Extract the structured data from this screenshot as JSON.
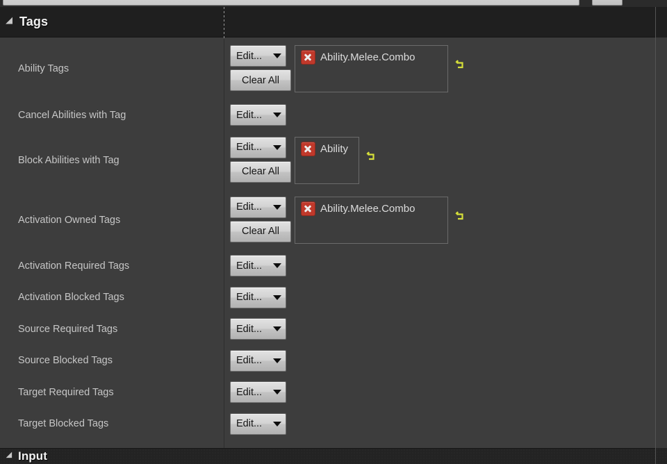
{
  "top_bar": {
    "search_placeholder": "",
    "search_value": "",
    "search_icon": "search-icon",
    "button_label": ""
  },
  "sections": [
    {
      "title": "Tags",
      "expanded": true,
      "triangle_icon": "triangle-down-icon"
    },
    {
      "title": "Input",
      "expanded": true,
      "triangle_icon": "triangle-down-icon"
    }
  ],
  "buttons": {
    "edit_label": "Edit...",
    "clear_all_label": "Clear All",
    "caret_icon": "chevron-down-icon",
    "revert_icon": "revert-arrow-icon",
    "remove_icon": "remove-x-icon"
  },
  "colors": {
    "panel_bg": "#3d3d3d",
    "header_bg": "#1f1f1f",
    "label_text": "#c6c6c6",
    "title_text": "#f1f1f1",
    "chip_remove": "#c0392b",
    "revert_arrow": "#d6e03a",
    "button_face": "#d2d2d2"
  },
  "rows": [
    {
      "label": "Ability Tags",
      "has_clear_all": true,
      "box": "wide",
      "tags": [
        "Ability.Melee.Combo"
      ],
      "has_revert": true
    },
    {
      "label": "Cancel Abilities with Tag",
      "has_clear_all": false,
      "box": null,
      "tags": [],
      "has_revert": false
    },
    {
      "label": "Block Abilities with Tag",
      "has_clear_all": true,
      "box": "narrow",
      "tags": [
        "Ability"
      ],
      "has_revert": true
    },
    {
      "label": "Activation Owned Tags",
      "has_clear_all": true,
      "box": "wide",
      "tags": [
        "Ability.Melee.Combo"
      ],
      "has_revert": true
    },
    {
      "label": "Activation Required Tags",
      "has_clear_all": false,
      "box": null,
      "tags": [],
      "has_revert": false
    },
    {
      "label": "Activation Blocked Tags",
      "has_clear_all": false,
      "box": null,
      "tags": [],
      "has_revert": false
    },
    {
      "label": "Source Required Tags",
      "has_clear_all": false,
      "box": null,
      "tags": [],
      "has_revert": false
    },
    {
      "label": "Source Blocked Tags",
      "has_clear_all": false,
      "box": null,
      "tags": [],
      "has_revert": false
    },
    {
      "label": "Target Required Tags",
      "has_clear_all": false,
      "box": null,
      "tags": [],
      "has_revert": false
    },
    {
      "label": "Target Blocked Tags",
      "has_clear_all": false,
      "box": null,
      "tags": [],
      "has_revert": false
    }
  ]
}
